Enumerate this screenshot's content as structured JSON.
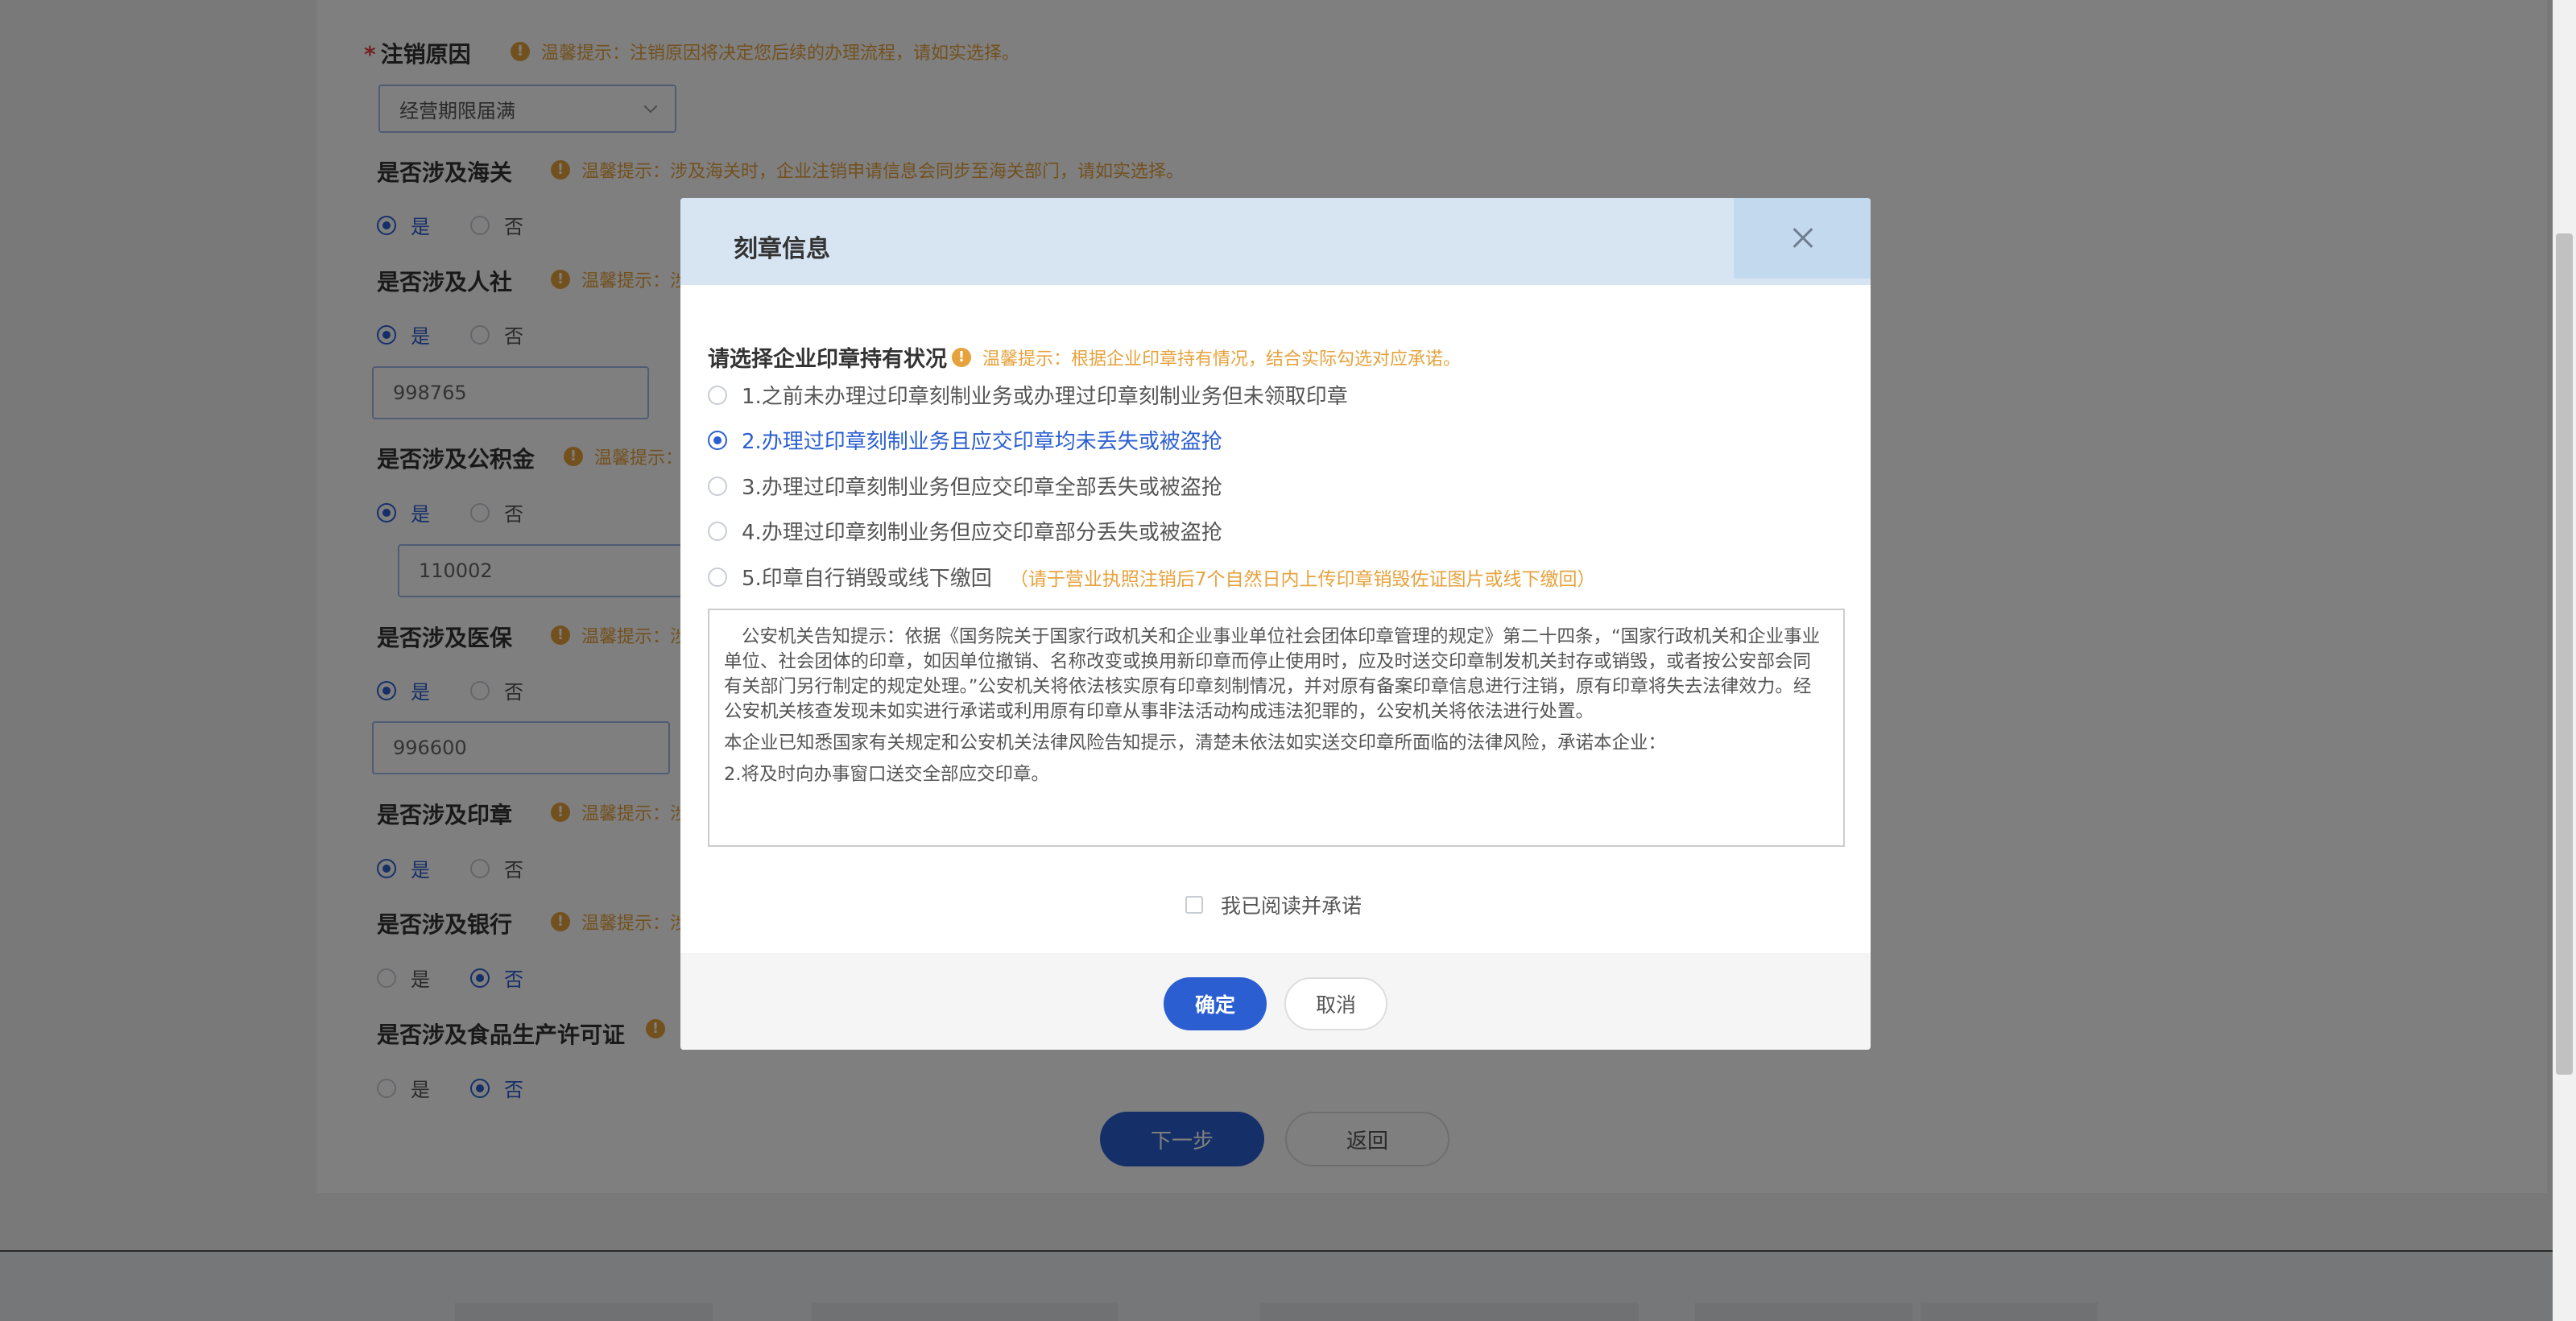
{
  "form": {
    "cancel_reason": {
      "label": "注销原因",
      "required_mark": "*",
      "tip": "温馨提示：注销原因将决定您后续的办理流程，请如实选择。",
      "selected": "经营期限届满"
    },
    "customs": {
      "label": "是否涉及海关",
      "tip": "温馨提示：涉及海关时，企业注销申请信息会同步至海关部门，请如实选择。",
      "yes": "是",
      "no": "否"
    },
    "social": {
      "label": "是否涉及人社",
      "tip": "温馨提示：涉",
      "yes": "是",
      "no": "否",
      "value": "998765"
    },
    "fund": {
      "label": "是否涉及公积金",
      "tip": "温馨提示：",
      "yes": "是",
      "no": "否",
      "value": "110002"
    },
    "medical": {
      "label": "是否涉及医保",
      "tip": "温馨提示：涉",
      "yes": "是",
      "no": "否",
      "value": "996600"
    },
    "seal": {
      "label": "是否涉及印章",
      "tip": "温馨提示：涉",
      "yes": "是",
      "no": "否"
    },
    "bank": {
      "label": "是否涉及银行",
      "tip": "温馨提示：涉",
      "yes": "是",
      "no": "否"
    },
    "food": {
      "label": "是否涉及食品生产许可证",
      "yes": "是",
      "no": "否"
    },
    "next_label": "下一步",
    "back_label": "返回"
  },
  "modal": {
    "title": "刻章信息",
    "question": "请选择企业印章持有状况",
    "question_tip": "温馨提示：根据企业印章持有情况，结合实际勾选对应承诺。",
    "options": [
      {
        "label": "1.之前未办理过印章刻制业务或办理过印章刻制业务但未领取印章"
      },
      {
        "label": "2.办理过印章刻制业务且应交印章均未丢失或被盗抢"
      },
      {
        "label": "3.办理过印章刻制业务但应交印章全部丢失或被盗抢"
      },
      {
        "label": "4.办理过印章刻制业务但应交印章部分丢失或被盗抢"
      },
      {
        "label": "5.印章自行销毁或线下缴回",
        "hint": "（请于营业执照注销后7个自然日内上传印章销毁佐证图片或线下缴回）"
      }
    ],
    "selected_option_index": 1,
    "notice": {
      "paragraph1": "公安机关告知提示：依据《国务院关于国家行政机关和企业事业单位社会团体印章管理的规定》第二十四条，“国家行政机关和企业事业单位、社会团体的印章，如因单位撤销、名称改变或换用新印章而停止使用时，应及时送交印章制发机关封存或销毁，或者按公安部会同有关部门另行制定的规定处理。”公安机关将依法核实原有印章刻制情况，并对原有备案印章信息进行注销，原有印章将失去法律效力。经公安机关核查发现未如实进行承诺或利用原有印章从事非法活动构成违法犯罪的，公安机关将依法进行处置。",
      "paragraph2": "本企业已知悉国家有关规定和公安机关法律风险告知提示，清楚未依法如实送交印章所面临的法律风险，承诺本企业：",
      "paragraph3": "2.将及时向办事窗口送交全部应交印章。"
    },
    "agree_label": "我已阅读并承诺",
    "ok_label": "确定",
    "cancel_label": "取消"
  },
  "icons": {
    "warning": "exclamation-circle-icon",
    "close": "close-icon",
    "dropdown": "chevron-down-icon"
  },
  "colors": {
    "primary": "#2b5fd1",
    "warning": "#e6a23c",
    "required": "#e64545",
    "modal_header": "#d7e5f3"
  }
}
